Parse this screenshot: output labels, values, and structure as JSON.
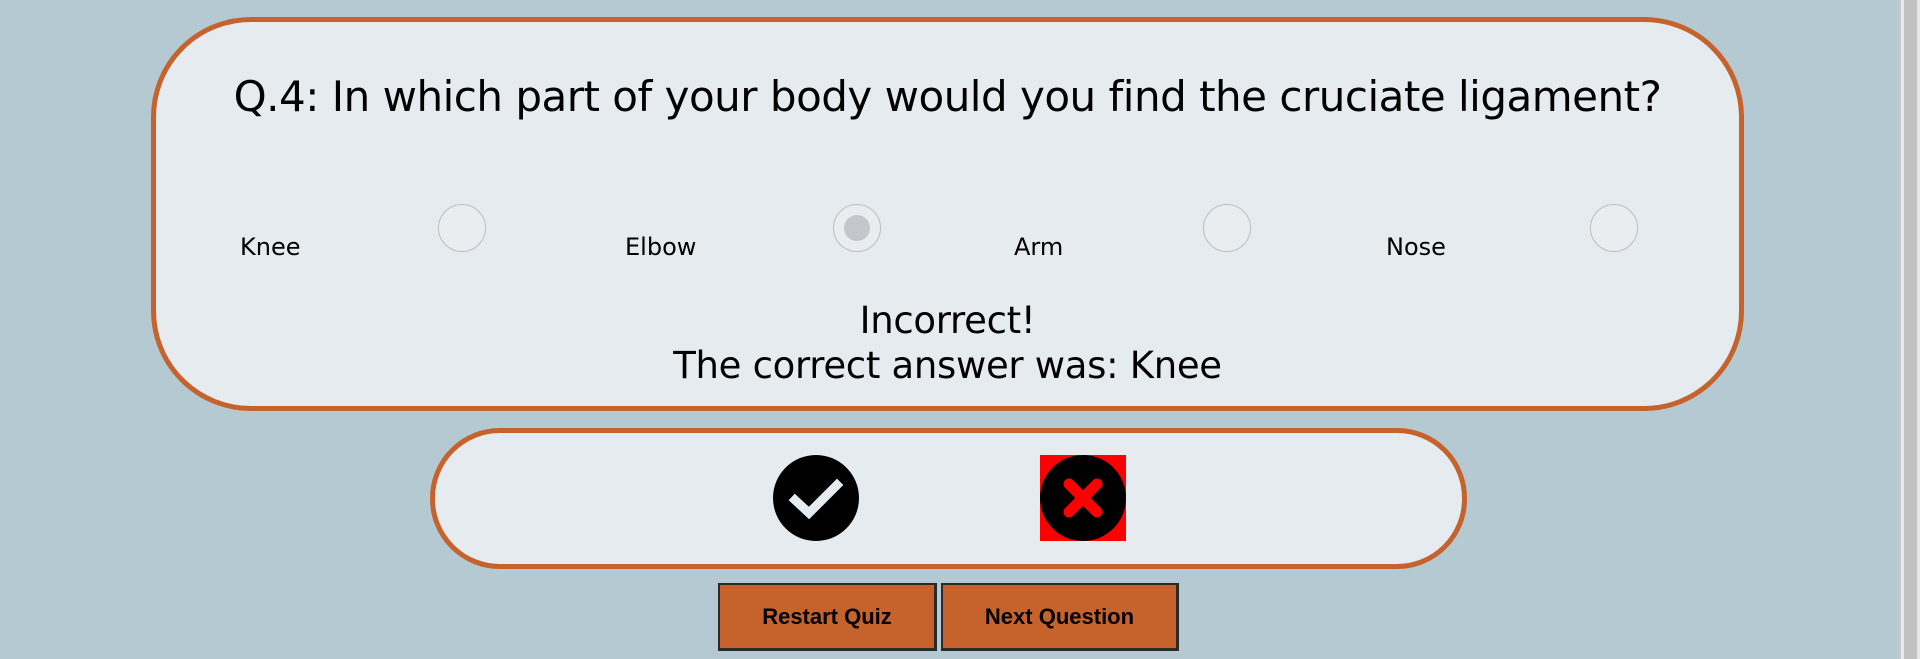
{
  "question": {
    "text": "Q.4: In which part of your body would you find the cruciate ligament?",
    "options": [
      {
        "label": "Knee",
        "selected": false
      },
      {
        "label": "Elbow",
        "selected": true
      },
      {
        "label": "Arm",
        "selected": false
      },
      {
        "label": "Nose",
        "selected": false
      }
    ],
    "feedback": {
      "result": "Incorrect!",
      "correct_answer": "The correct answer was: Knee"
    }
  },
  "score": {
    "icons": [
      "check-circle-icon",
      "x-circle-icon"
    ],
    "colors": {
      "check": "#000000",
      "x_background": "#ff0000",
      "x_circle": "#000000"
    }
  },
  "buttons": {
    "restart_label": "Restart Quiz",
    "next_label": "Next Question"
  },
  "colors": {
    "background": "#b4c9d1",
    "card": "#e6ebef",
    "accent": "#c6622b"
  }
}
